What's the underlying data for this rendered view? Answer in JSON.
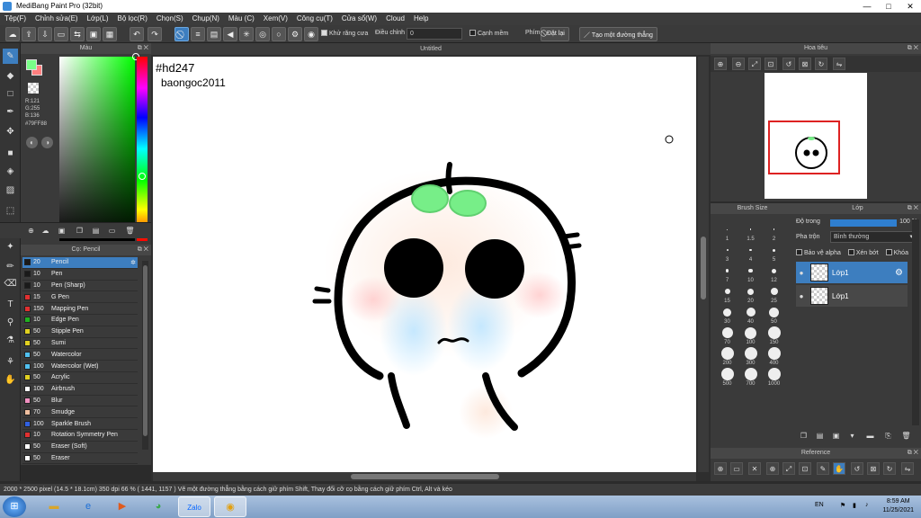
{
  "window": {
    "title": "MediBang Paint Pro (32bit)",
    "minimize": "—",
    "maximize": "□",
    "close": "✕"
  },
  "menu": [
    "Tệp(F)",
    "Chỉnh sửa(E)",
    "Lớp(L)",
    "Bộ lọc(R)",
    "Chọn(S)",
    "Chụp(N)",
    "Màu (C)",
    "Xem(V)",
    "Công cụ(T)",
    "Cửa sổ(W)",
    "Cloud",
    "Help"
  ],
  "toolbar": {
    "antialias_label": "Khử răng cưa",
    "adjust_label": "Điều chỉnh",
    "adjust_value": "0",
    "soft_edge_label": "Cạnh mềm",
    "key_label": "Phím",
    "reset_label": "Đặt lại",
    "straight_line_label": "Tạo một đường thẳng"
  },
  "color_panel": {
    "title": "Màu",
    "fg_color": "#79FF88",
    "bg_color": "#FF7F7F",
    "rgb_text": "R:121\nG:255\nB:136",
    "hex_text": "#79FF88"
  },
  "brush_panel": {
    "title": "Cọ: Pencil",
    "brushes": [
      {
        "size": "20",
        "name": "Pencil",
        "color": "#1a1a1a",
        "selected": true
      },
      {
        "size": "10",
        "name": "Pen",
        "color": "#1a1a1a"
      },
      {
        "size": "10",
        "name": "Pen (Sharp)",
        "color": "#1a1a1a"
      },
      {
        "size": "15",
        "name": "G Pen",
        "color": "#e03030"
      },
      {
        "size": "150",
        "name": "Mapping Pen",
        "color": "#e03030"
      },
      {
        "size": "10",
        "name": "Edge Pen",
        "color": "#20b020"
      },
      {
        "size": "50",
        "name": "Stipple Pen",
        "color": "#e0d020"
      },
      {
        "size": "50",
        "name": "Sumi",
        "color": "#e0d020"
      },
      {
        "size": "50",
        "name": "Watercolor",
        "color": "#50c0f0"
      },
      {
        "size": "100",
        "name": "Watercolor (Wet)",
        "color": "#50c0f0"
      },
      {
        "size": "50",
        "name": "Acrylic",
        "color": "#e0d020"
      },
      {
        "size": "100",
        "name": "Airbrush",
        "color": "#ffffff"
      },
      {
        "size": "50",
        "name": "Blur",
        "color": "#f090c0"
      },
      {
        "size": "70",
        "name": "Smudge",
        "color": "#f0c0a0"
      },
      {
        "size": "100",
        "name": "Sparkle Brush",
        "color": "#3060e0"
      },
      {
        "size": "10",
        "name": "Rotation Symmetry Pen",
        "color": "#e03030"
      },
      {
        "size": "50",
        "name": "Eraser (Soft)",
        "color": "#ffffff"
      },
      {
        "size": "50",
        "name": "Eraser",
        "color": "#ffffff"
      }
    ]
  },
  "document": {
    "tab_title": "Untitled",
    "text_line1": "#hd247",
    "text_line2": "baongoc2011"
  },
  "navigator": {
    "title": "Hoa tiêu"
  },
  "brush_size": {
    "title": "Brush Size",
    "sizes": [
      "1",
      "1.5",
      "2",
      "3",
      "4",
      "5",
      "7",
      "10",
      "12",
      "15",
      "20",
      "25",
      "30",
      "40",
      "50",
      "70",
      "100",
      "150",
      "200",
      "300",
      "400",
      "500",
      "700",
      "1000"
    ]
  },
  "layer_panel": {
    "title": "Lớp",
    "opacity_label": "Độ trong",
    "opacity_value": "100 %",
    "blend_label": "Pha trộn",
    "blend_value": "Bình thường",
    "protect_alpha": "Bảo vệ alpha",
    "clipping": "Xén bớt",
    "lock": "Khóa",
    "layers": [
      {
        "name": "Lớp1",
        "selected": true
      },
      {
        "name": "Lớp1",
        "selected": false
      }
    ]
  },
  "reference_panel": {
    "title": "Reference"
  },
  "status": {
    "text": "2000 * 2500 pixel   (14.5 * 18.1cm)   350 dpi   66 %   ( 1441, 1157 )   Vẽ một đường thẳng bằng cách giữ phím Shift, Thay đổi cỡ cọ bằng cách giữ phím Ctrl, Alt và kéo"
  },
  "taskbar": {
    "language": "EN",
    "time": "8:59 AM",
    "date": "11/25/2021"
  }
}
